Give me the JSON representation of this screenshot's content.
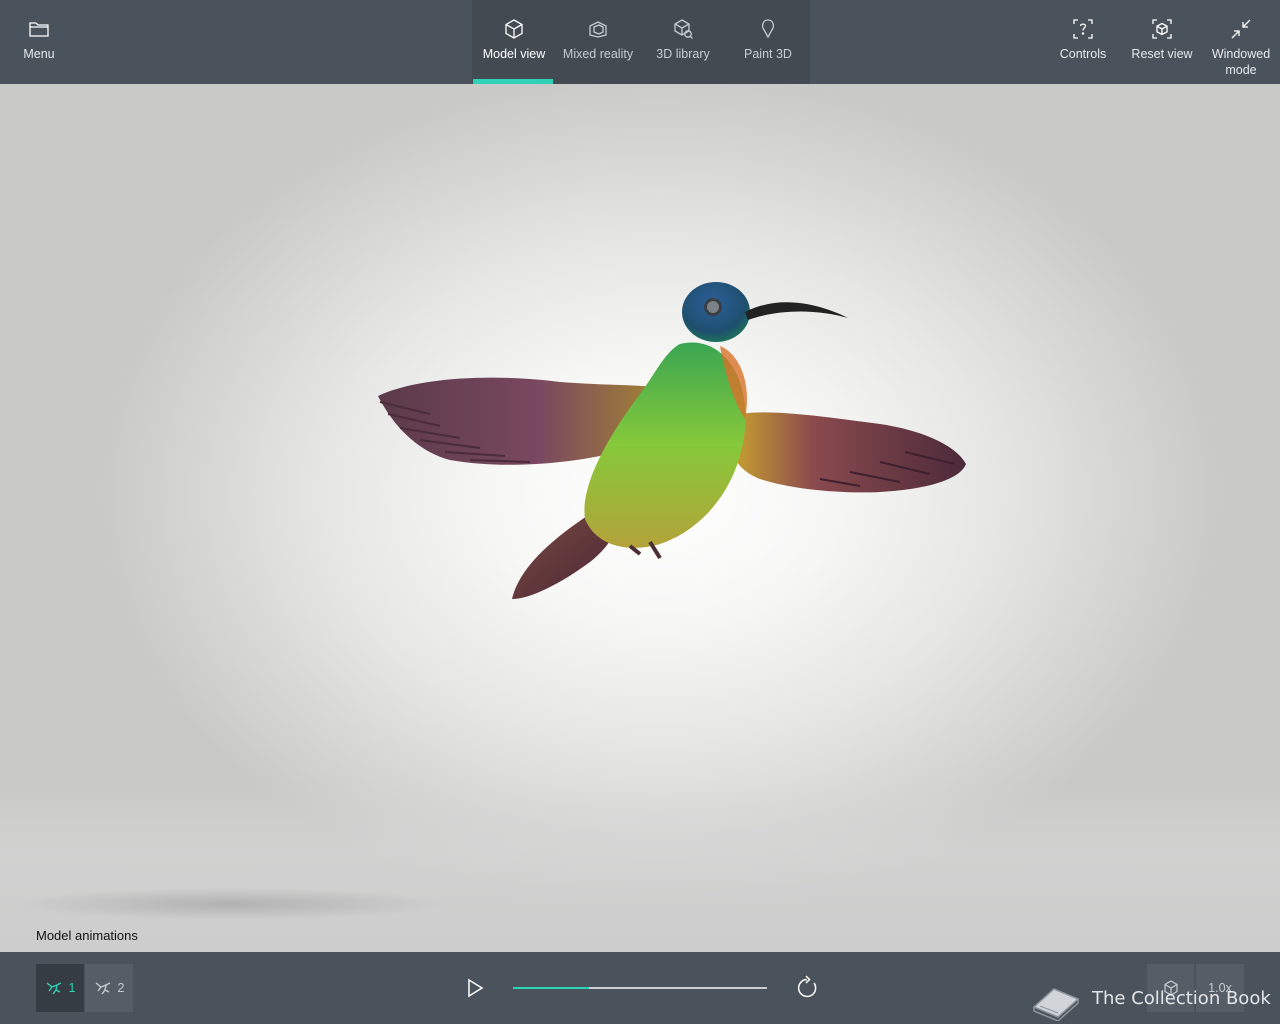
{
  "menu": {
    "label": "Menu",
    "icon": "folder-icon"
  },
  "tabs": [
    {
      "label": "Model view",
      "icon": "cube-icon",
      "active": true
    },
    {
      "label": "Mixed reality",
      "icon": "mixed-reality-icon",
      "active": false
    },
    {
      "label": "3D library",
      "icon": "library-icon",
      "active": false
    },
    {
      "label": "Paint 3D",
      "icon": "paint3d-icon",
      "active": false
    }
  ],
  "actions": {
    "controls": {
      "label": "Controls",
      "icon": "controls-help-icon"
    },
    "reset_view": {
      "label": "Reset view",
      "icon": "reset-view-icon"
    },
    "windowed_mode": {
      "label": "Windowed mode",
      "icon": "windowed-mode-icon"
    }
  },
  "viewport": {
    "animations_label": "Model animations"
  },
  "animations": [
    {
      "label": "1",
      "active": true
    },
    {
      "label": "2",
      "active": false
    }
  ],
  "playback": {
    "progress": 0.3
  },
  "speed": {
    "label": "1.0x"
  },
  "watermark": {
    "text": "The Collection Book"
  },
  "colors": {
    "accent": "#2ed3b7",
    "bar_bg": "#4a525b"
  }
}
